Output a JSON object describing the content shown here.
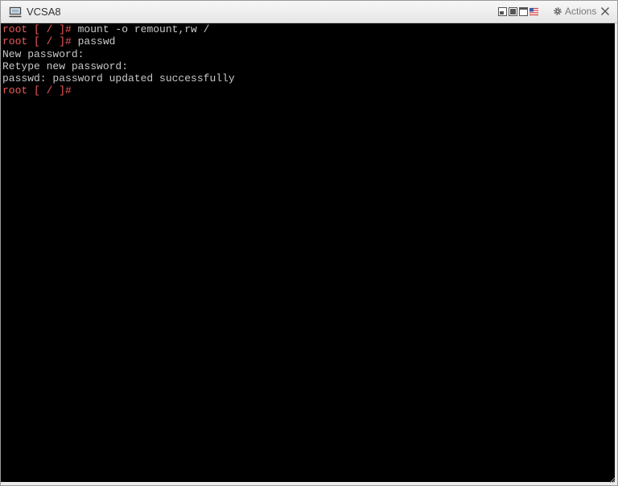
{
  "window": {
    "title": "VCSA8",
    "actions_label": "Actions"
  },
  "toolbar_icons": [
    "send-ctrl-alt-del-icon",
    "fit-window-icon",
    "fullscreen-icon",
    "keyboard-language-icon",
    "gear-icon"
  ],
  "colors": {
    "prompt": "#f25a5a",
    "text": "#c8c8c8",
    "background": "#000000"
  },
  "console": {
    "lines": [
      {
        "prompt": "root [ / ]#",
        "text": " mount -o remount,rw /"
      },
      {
        "prompt": "root [ / ]#",
        "text": " passwd"
      },
      {
        "prompt": "",
        "text": "New password:"
      },
      {
        "prompt": "",
        "text": "Retype new password:"
      },
      {
        "prompt": "",
        "text": "passwd: password updated successfully"
      },
      {
        "prompt": "root [ / ]#",
        "text": ""
      }
    ]
  }
}
